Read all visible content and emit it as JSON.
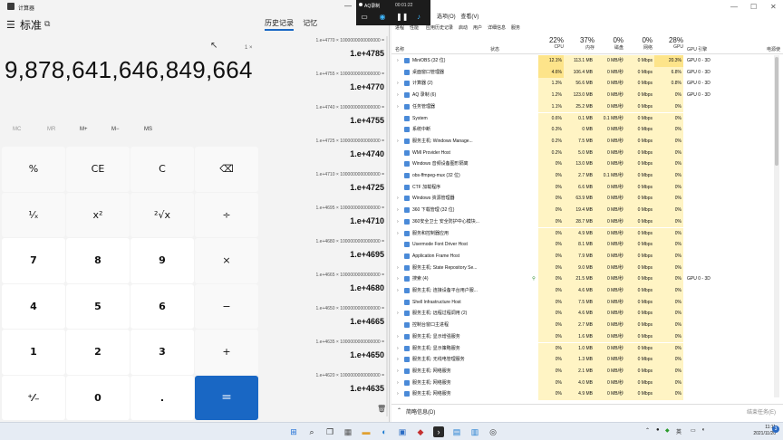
{
  "calculator": {
    "window_title": "计算器",
    "mode": "标准",
    "tabs": [
      "历史记录",
      "记忆"
    ],
    "expression_count": "1 ×",
    "display": "9,878,641,646,849,664",
    "memory": [
      "MC",
      "MR",
      "M+",
      "M−",
      "MS"
    ],
    "keys": [
      "%",
      "CE",
      "C",
      "⌫",
      "¹⁄ₓ",
      "x²",
      "²√x",
      "÷",
      "7",
      "8",
      "9",
      "×",
      "4",
      "5",
      "6",
      "−",
      "1",
      "2",
      "3",
      "+",
      "⁺⁄₋",
      "0",
      ".",
      "="
    ],
    "history": [
      {
        "expr": "1.e+4770   ×   1000000000000000 =",
        "result": "1.e+4785"
      },
      {
        "expr": "1.e+4755   ×   1000000000000000 =",
        "result": "1.e+4770"
      },
      {
        "expr": "1.e+4740   ×   1000000000000000 =",
        "result": "1.e+4755"
      },
      {
        "expr": "1.e+4725   ×   1000000000000000 =",
        "result": "1.e+4740"
      },
      {
        "expr": "1.e+4710   ×   1000000000000000 =",
        "result": "1.e+4725"
      },
      {
        "expr": "1.e+4695   ×   1000000000000000 =",
        "result": "1.e+4710"
      },
      {
        "expr": "1.e+4680   ×   1000000000000000 =",
        "result": "1.e+4695"
      },
      {
        "expr": "1.e+4665   ×   1000000000000000 =",
        "result": "1.e+4680"
      },
      {
        "expr": "1.e+4650   ×   1000000000000000 =",
        "result": "1.e+4665"
      },
      {
        "expr": "1.e+4635   ×   1000000000000000 =",
        "result": "1.e+4650"
      },
      {
        "expr": "1.e+4620   ×   1000000000000000 =",
        "result": "1.e+4635"
      }
    ]
  },
  "recorder": {
    "title": "AQ录制",
    "time": "00:01:22"
  },
  "task_manager": {
    "menu": [
      "选项(O)",
      "查看(V)"
    ],
    "tabs": [
      "进程",
      "性能",
      "应用历史记录",
      "启动",
      "用户",
      "详细信息",
      "服务"
    ],
    "columns": {
      "name": "名称",
      "status": "状态",
      "cpu": {
        "pct": "22%",
        "label": "CPU"
      },
      "memory": {
        "pct": "37%",
        "label": "内存"
      },
      "disk": {
        "pct": "0%",
        "label": "磁盘"
      },
      "network": {
        "pct": "0%",
        "label": "网络"
      },
      "gpu": {
        "pct": "28%",
        "label": "GPU"
      },
      "gpu_engine": "GPU 引擎",
      "power": "电源使"
    },
    "rows": [
      {
        "name": "MiniOBS (32 位)",
        "cpu": "12.1%",
        "mem": "113.1 MB",
        "disk": "0 MB/秒",
        "net": "0 Mbps",
        "gpu": "20.3%",
        "engine": "GPU 0 - 3D",
        "chev": true
      },
      {
        "name": "桌面窗口管理器",
        "cpu": "4.6%",
        "mem": "106.4 MB",
        "disk": "0 MB/秒",
        "net": "0 Mbps",
        "gpu": "6.8%",
        "engine": "GPU 0 - 3D",
        "chev": false
      },
      {
        "name": "计算器 (2)",
        "cpu": "1.3%",
        "mem": "56.6 MB",
        "disk": "0 MB/秒",
        "net": "0 Mbps",
        "gpu": "0.8%",
        "engine": "GPU 0 - 3D",
        "chev": true
      },
      {
        "name": "AQ 录制 (6)",
        "cpu": "1.2%",
        "mem": "123.0 MB",
        "disk": "0 MB/秒",
        "net": "0 Mbps",
        "gpu": "0%",
        "engine": "GPU 0 - 3D",
        "chev": true
      },
      {
        "name": "任务管理器",
        "cpu": "1.1%",
        "mem": "25.2 MB",
        "disk": "0 MB/秒",
        "net": "0 Mbps",
        "gpu": "0%",
        "engine": "",
        "chev": true
      },
      {
        "name": "System",
        "cpu": "0.6%",
        "mem": "0.1 MB",
        "disk": "0.1 MB/秒",
        "net": "0 Mbps",
        "gpu": "0%",
        "engine": "",
        "chev": false
      },
      {
        "name": "系统中断",
        "cpu": "0.3%",
        "mem": "0 MB",
        "disk": "0 MB/秒",
        "net": "0 Mbps",
        "gpu": "0%",
        "engine": "",
        "chev": false
      },
      {
        "name": "服务主机: Windows Manage...",
        "cpu": "0.2%",
        "mem": "7.5 MB",
        "disk": "0 MB/秒",
        "net": "0 Mbps",
        "gpu": "0%",
        "engine": "",
        "chev": true
      },
      {
        "name": "WMI Provider Host",
        "cpu": "0.2%",
        "mem": "5.0 MB",
        "disk": "0 MB/秒",
        "net": "0 Mbps",
        "gpu": "0%",
        "engine": "",
        "chev": false
      },
      {
        "name": "Windows 音频设备图形隔离",
        "cpu": "0%",
        "mem": "13.0 MB",
        "disk": "0 MB/秒",
        "net": "0 Mbps",
        "gpu": "0%",
        "engine": "",
        "chev": false
      },
      {
        "name": "obs-ffmpeg-mux (32 位)",
        "cpu": "0%",
        "mem": "2.7 MB",
        "disk": "0.1 MB/秒",
        "net": "0 Mbps",
        "gpu": "0%",
        "engine": "",
        "chev": false
      },
      {
        "name": "CTF 加载程序",
        "cpu": "0%",
        "mem": "6.6 MB",
        "disk": "0 MB/秒",
        "net": "0 Mbps",
        "gpu": "0%",
        "engine": "",
        "chev": false
      },
      {
        "name": "Windows 资源管理器",
        "cpu": "0%",
        "mem": "63.9 MB",
        "disk": "0 MB/秒",
        "net": "0 Mbps",
        "gpu": "0%",
        "engine": "",
        "chev": true
      },
      {
        "name": "360 下载管理 (32 位)",
        "cpu": "0%",
        "mem": "19.4 MB",
        "disk": "0 MB/秒",
        "net": "0 Mbps",
        "gpu": "0%",
        "engine": "",
        "chev": true
      },
      {
        "name": "360安全卫士 安全防护中心模块...",
        "cpu": "0%",
        "mem": "28.7 MB",
        "disk": "0 MB/秒",
        "net": "0 Mbps",
        "gpu": "0%",
        "engine": "",
        "chev": true
      },
      {
        "name": "服务和控制器应用",
        "cpu": "0%",
        "mem": "4.9 MB",
        "disk": "0 MB/秒",
        "net": "0 Mbps",
        "gpu": "0%",
        "engine": "",
        "chev": true
      },
      {
        "name": "Usermode Font Driver Host",
        "cpu": "0%",
        "mem": "8.1 MB",
        "disk": "0 MB/秒",
        "net": "0 Mbps",
        "gpu": "0%",
        "engine": "",
        "chev": false
      },
      {
        "name": "Application Frame Host",
        "cpu": "0%",
        "mem": "7.9 MB",
        "disk": "0 MB/秒",
        "net": "0 Mbps",
        "gpu": "0%",
        "engine": "",
        "chev": false
      },
      {
        "name": "服务主机: State Repository Se...",
        "cpu": "0%",
        "mem": "9.0 MB",
        "disk": "0 MB/秒",
        "net": "0 Mbps",
        "gpu": "0%",
        "engine": "",
        "chev": true
      },
      {
        "name": "搜索 (4)",
        "cpu": "0%",
        "mem": "21.5 MB",
        "disk": "0 MB/秒",
        "net": "0 Mbps",
        "gpu": "0%",
        "engine": "GPU 0 - 3D",
        "chev": true,
        "leaf": true
      },
      {
        "name": "服务主机: 连接设备平台用户服...",
        "cpu": "0%",
        "mem": "4.6 MB",
        "disk": "0 MB/秒",
        "net": "0 Mbps",
        "gpu": "0%",
        "engine": "",
        "chev": true
      },
      {
        "name": "Shell Infrastructure Host",
        "cpu": "0%",
        "mem": "7.5 MB",
        "disk": "0 MB/秒",
        "net": "0 Mbps",
        "gpu": "0%",
        "engine": "",
        "chev": false
      },
      {
        "name": "服务主机: 远程过程调用 (2)",
        "cpu": "0%",
        "mem": "4.6 MB",
        "disk": "0 MB/秒",
        "net": "0 Mbps",
        "gpu": "0%",
        "engine": "",
        "chev": true
      },
      {
        "name": "控制台窗口主进程",
        "cpu": "0%",
        "mem": "2.7 MB",
        "disk": "0 MB/秒",
        "net": "0 Mbps",
        "gpu": "0%",
        "engine": "",
        "chev": false
      },
      {
        "name": "服务主机: 显示增强服务",
        "cpu": "0%",
        "mem": "1.6 MB",
        "disk": "0 MB/秒",
        "net": "0 Mbps",
        "gpu": "0%",
        "engine": "",
        "chev": true
      },
      {
        "name": "服务主机: 显示策略服务",
        "cpu": "0%",
        "mem": "1.0 MB",
        "disk": "0 MB/秒",
        "net": "0 Mbps",
        "gpu": "0%",
        "engine": "",
        "chev": true
      },
      {
        "name": "服务主机: 无线电管理服务",
        "cpu": "0%",
        "mem": "1.3 MB",
        "disk": "0 MB/秒",
        "net": "0 Mbps",
        "gpu": "0%",
        "engine": "",
        "chev": true
      },
      {
        "name": "服务主机: 网络服务",
        "cpu": "0%",
        "mem": "2.1 MB",
        "disk": "0 MB/秒",
        "net": "0 Mbps",
        "gpu": "0%",
        "engine": "",
        "chev": true
      },
      {
        "name": "服务主机: 网络服务",
        "cpu": "0%",
        "mem": "4.0 MB",
        "disk": "0 MB/秒",
        "net": "0 Mbps",
        "gpu": "0%",
        "engine": "",
        "chev": true
      },
      {
        "name": "服务主机: 网络服务",
        "cpu": "0%",
        "mem": "4.9 MB",
        "disk": "0 MB/秒",
        "net": "0 Mbps",
        "gpu": "0%",
        "engine": "",
        "chev": true
      }
    ],
    "footer": "简略信息(D)",
    "end_task": "结束任务(E)"
  },
  "taskbar": {
    "ime": "英",
    "time": "11:11",
    "date": "2021/11/20",
    "notifications": "3"
  }
}
